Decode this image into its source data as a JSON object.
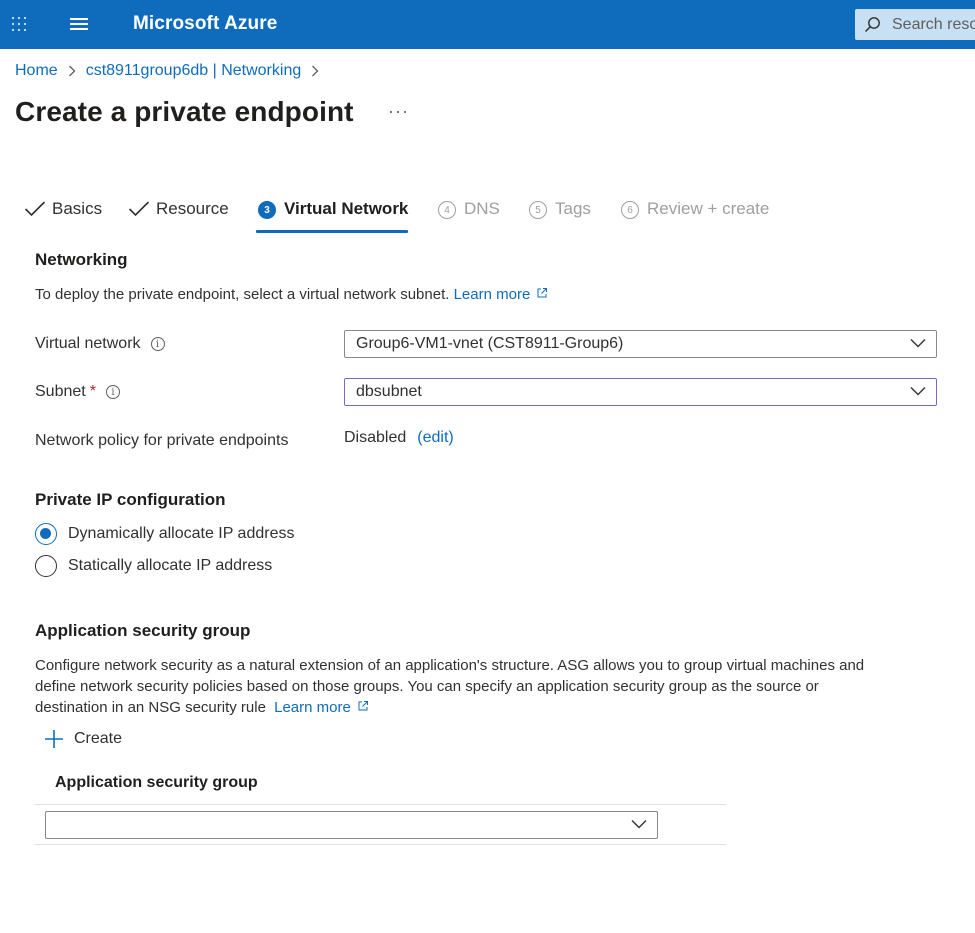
{
  "topbar": {
    "brand": "Microsoft Azure",
    "search_placeholder": "Search reso"
  },
  "breadcrumb": {
    "items": [
      "Home",
      "cst8911group6db | Networking"
    ]
  },
  "page": {
    "title": "Create a private endpoint",
    "more": "···"
  },
  "tabs": [
    {
      "label": "Basics",
      "state": "done"
    },
    {
      "label": "Resource",
      "state": "done"
    },
    {
      "number": "3",
      "label": "Virtual Network",
      "state": "active"
    },
    {
      "number": "4",
      "label": "DNS",
      "state": "disabled"
    },
    {
      "number": "5",
      "label": "Tags",
      "state": "disabled"
    },
    {
      "number": "6",
      "label": "Review + create",
      "state": "disabled"
    }
  ],
  "networking": {
    "heading": "Networking",
    "description": "To deploy the private endpoint, select a virtual network subnet.",
    "learn_more": "Learn more",
    "vnet_label": "Virtual network",
    "vnet_value": "Group6-VM1-vnet (CST8911-Group6)",
    "subnet_label": "Subnet",
    "required_mark": "*",
    "subnet_value": "dbsubnet",
    "policy_label": "Network policy for private endpoints",
    "policy_value": "Disabled",
    "policy_edit": "(edit)"
  },
  "private_ip": {
    "heading": "Private IP configuration",
    "options": [
      {
        "label": "Dynamically allocate IP address",
        "selected": true
      },
      {
        "label": "Statically allocate IP address",
        "selected": false
      }
    ]
  },
  "asg": {
    "heading": "Application security group",
    "description_line1": "Configure network security as a natural extension of an application's structure. ASG allows you to group virtual machines and",
    "description_line2": "define network security policies based on those groups. You can specify an application security group as the source or",
    "description_line3": "destination in an NSG security rule",
    "learn_more": "Learn more",
    "create_label": "Create",
    "column_header": "Application security group",
    "select_value": ""
  },
  "colors": {
    "accent": "#0f6cbd",
    "focus_border": "#8764b8",
    "required": "#a4262c",
    "disabled_text": "#a19f9d"
  },
  "icons": [
    "app-launcher-icon",
    "hamburger-menu-icon",
    "search-icon",
    "chevron-right-icon",
    "checkmark-icon",
    "info-icon",
    "chevron-down-icon",
    "external-link-icon",
    "plus-icon"
  ]
}
